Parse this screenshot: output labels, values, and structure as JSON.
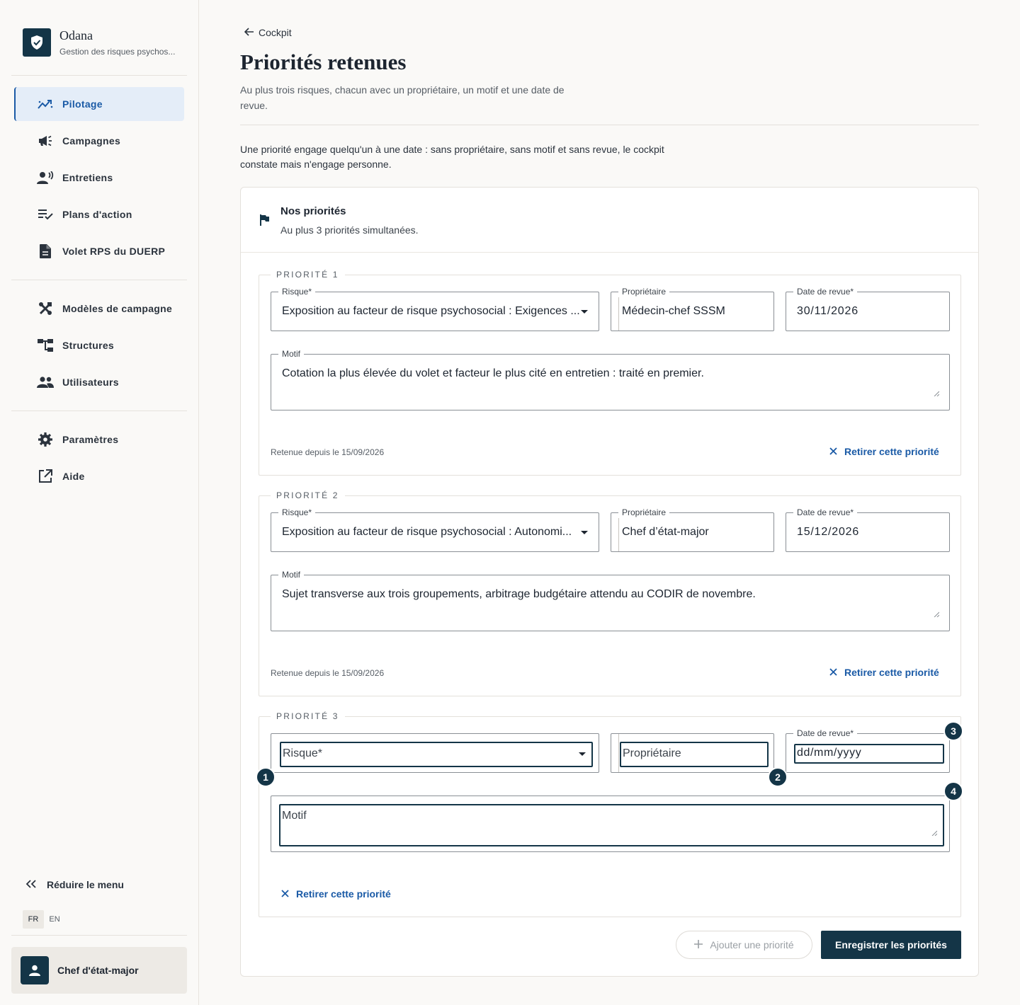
{
  "brand": {
    "name": "Odana",
    "subtitle": "Gestion des risques psychos..."
  },
  "nav": {
    "primary": [
      {
        "label": "Pilotage",
        "icon": "chart-line-icon",
        "active": true
      },
      {
        "label": "Campagnes",
        "icon": "megaphone-icon"
      },
      {
        "label": "Entretiens",
        "icon": "person-voice-icon"
      },
      {
        "label": "Plans d'action",
        "icon": "checklist-icon"
      },
      {
        "label": "Volet RPS du DUERP",
        "icon": "document-icon"
      }
    ],
    "secondary": [
      {
        "label": "Modèles de campagne",
        "icon": "tools-icon"
      },
      {
        "label": "Structures",
        "icon": "hierarchy-icon"
      },
      {
        "label": "Utilisateurs",
        "icon": "users-icon"
      }
    ],
    "tertiary": [
      {
        "label": "Paramètres",
        "icon": "gear-icon"
      },
      {
        "label": "Aide",
        "icon": "external-link-icon"
      }
    ],
    "collapse_label": "Réduire le menu"
  },
  "lang": {
    "fr": "FR",
    "en": "EN",
    "active": "FR"
  },
  "user": {
    "name": "Chef d'état-major"
  },
  "page": {
    "back_label": "Cockpit",
    "title": "Priorités retenues",
    "subtitle": "Au plus trois risques, chacun avec un propriétaire, un motif et une date de revue.",
    "intro": "Une priorité engage quelqu'un à une date : sans propriétaire, sans motif et sans revue, le cockpit constate mais n'engage personne."
  },
  "card": {
    "title": "Nos priorités",
    "subtitle": "Au plus 3 priorités simultanées.",
    "priorities": [
      {
        "legend": "PRIORITÉ 1",
        "risk_label": "Risque*",
        "risk_value": "Exposition au facteur de risque psychosocial : Exigences ...",
        "owner_label": "Propriétaire",
        "owner_value": "Médecin-chef SSSM",
        "date_label": "Date de revue*",
        "date_value": "30/11/2026",
        "motif_label": "Motif",
        "motif_value": "Cotation la plus élevée du volet et facteur le plus cité en entretien : traité en premier.",
        "retenue": "Retenue depuis le 15/09/2026",
        "remove_label": "Retirer cette priorité"
      },
      {
        "legend": "PRIORITÉ 2",
        "risk_label": "Risque*",
        "risk_value": "Exposition au facteur de risque psychosocial : Autonomi...",
        "owner_label": "Propriétaire",
        "owner_value": "Chef d’état-major",
        "date_label": "Date de revue*",
        "date_value": "15/12/2026",
        "motif_label": "Motif",
        "motif_value": "Sujet transverse aux trois groupements, arbitrage budgétaire attendu au CODIR de novembre.",
        "retenue": "Retenue depuis le 15/09/2026",
        "remove_label": "Retirer cette priorité"
      },
      {
        "legend": "PRIORITÉ 3",
        "risk_placeholder": "Risque*",
        "owner_placeholder": "Propriétaire",
        "date_label": "Date de revue*",
        "date_placeholder": "dd/mm/yyyy",
        "motif_placeholder": "Motif",
        "remove_label": "Retirer cette priorité",
        "badges": [
          "1",
          "2",
          "3",
          "4"
        ]
      }
    ],
    "add_label": "Ajouter une priorité",
    "save_label": "Enregistrer les priorités"
  },
  "colors": {
    "primary": "#143547",
    "link": "#1a5aa6",
    "active_bg": "#e4edf8",
    "page_bg": "#faf9f7"
  }
}
